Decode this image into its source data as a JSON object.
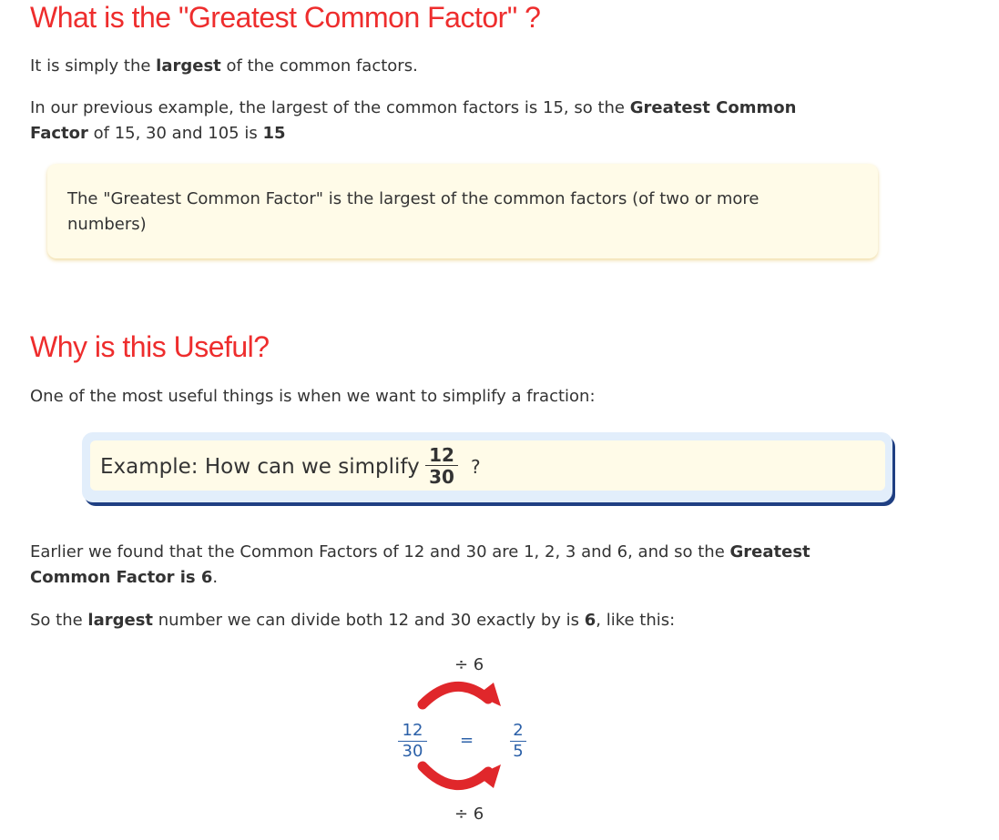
{
  "section1": {
    "heading": "What is the \"Greatest Common Factor\" ?",
    "p1": {
      "pre": "It is simply the ",
      "bold": "largest",
      "post": " of the common factors."
    },
    "p2": {
      "line1_pre": "In our previous example, the largest of the common factors is 15, so the ",
      "line1_bold": "Greatest Common",
      "line2_bold": "Factor",
      "line2_mid": " of 15, 30 and 105 is ",
      "line2_bold_end": "15"
    },
    "definition": {
      "line1": "The \"Greatest Common Factor\" is the largest of the common factors (of two or more",
      "line2": "numbers)"
    }
  },
  "section2": {
    "heading": "Why is this Useful?",
    "intro": "One of the most useful things is when we want to simplify a fraction:",
    "example": {
      "text": "Example: How can we simplify",
      "numerator": "12",
      "denominator": "30",
      "question_mark": "?"
    },
    "p3": {
      "line1_pre": "Earlier we found that the Common Factors of 12 and 30 are 1, 2, 3 and 6, and so the ",
      "line1_bold": "Greatest",
      "line2_bold": "Common Factor is 6",
      "line2_post": "."
    },
    "p4": {
      "pre": "So the ",
      "bold1": "largest",
      "mid": " number we can divide both 12 and 30 exactly by is ",
      "bold2": "6",
      "post": ", like this:"
    },
    "diagram": {
      "top_operation": "÷ 6",
      "bottom_operation": "÷ 6",
      "left_numerator": "12",
      "left_denominator": "30",
      "equals": "=",
      "right_numerator": "2",
      "right_denominator": "5",
      "arrow_color": "#e0272b"
    }
  }
}
